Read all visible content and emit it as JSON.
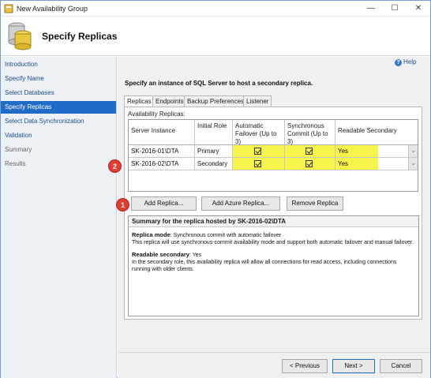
{
  "window": {
    "title": "New Availability Group",
    "controls": {
      "minimize": "—",
      "maximize": "☐",
      "close": "✕"
    }
  },
  "header": {
    "title": "Specify Replicas"
  },
  "sidebar": {
    "items": [
      {
        "label": "Introduction",
        "state": "link"
      },
      {
        "label": "Specify Name",
        "state": "link"
      },
      {
        "label": "Select Databases",
        "state": "link"
      },
      {
        "label": "Specify Replicas",
        "state": "active"
      },
      {
        "label": "Select Data Synchronization",
        "state": "link"
      },
      {
        "label": "Validation",
        "state": "link"
      },
      {
        "label": "Summary",
        "state": "disabled"
      },
      {
        "label": "Results",
        "state": "disabled"
      }
    ]
  },
  "main": {
    "help_label": "Help",
    "help_icon": "?",
    "intro": "Specify an instance of SQL Server to host a secondary replica.",
    "tabs": [
      {
        "label": "Replicas",
        "active": true
      },
      {
        "label": "Endpoints",
        "active": false
      },
      {
        "label": "Backup Preferences",
        "active": false
      },
      {
        "label": "Listener",
        "active": false
      }
    ],
    "panel_label": "Availability Replicas:",
    "columns": {
      "server": "Server Instance",
      "role": "Initial Role",
      "failover": "Automatic Failover (Up to 3)",
      "commit": "Synchronous Commit (Up to 3)",
      "readable": "Readable Secondary"
    },
    "rows": [
      {
        "server": "SK-2016-01\\DTA",
        "role": "Primary",
        "failover": true,
        "commit": true,
        "readable": "Yes"
      },
      {
        "server": "SK-2016-02\\DTA",
        "role": "Secondary",
        "failover": true,
        "commit": true,
        "readable": "Yes"
      }
    ],
    "dropdown_glyph": "⌄",
    "buttons": {
      "add_replica": "Add Replica...",
      "add_azure_replica": "Add Azure Replica...",
      "remove_replica": "Remove Replica"
    },
    "summary": {
      "title": "Summary for the replica hosted by SK-2016-02\\DTA",
      "replica_mode_label": "Replica mode",
      "replica_mode_value": ": Synchronous commit with automatic failover",
      "replica_mode_desc": "This replica will use synchronous-commit availability mode and support both automatic failover and manual failover.",
      "readable_label": "Readable secondary",
      "readable_value": ": Yes",
      "readable_desc": "In the secondary role, this availability replica will allow all connections for read access, including connections running with older clients."
    }
  },
  "footer": {
    "previous": "< Previous",
    "next": "Next >",
    "cancel": "Cancel"
  },
  "annotations": {
    "badge1": "1",
    "badge2": "2"
  },
  "colors": {
    "highlight": "#f6f34a",
    "accent": "#1e6cc8",
    "badge": "#e03c31"
  }
}
